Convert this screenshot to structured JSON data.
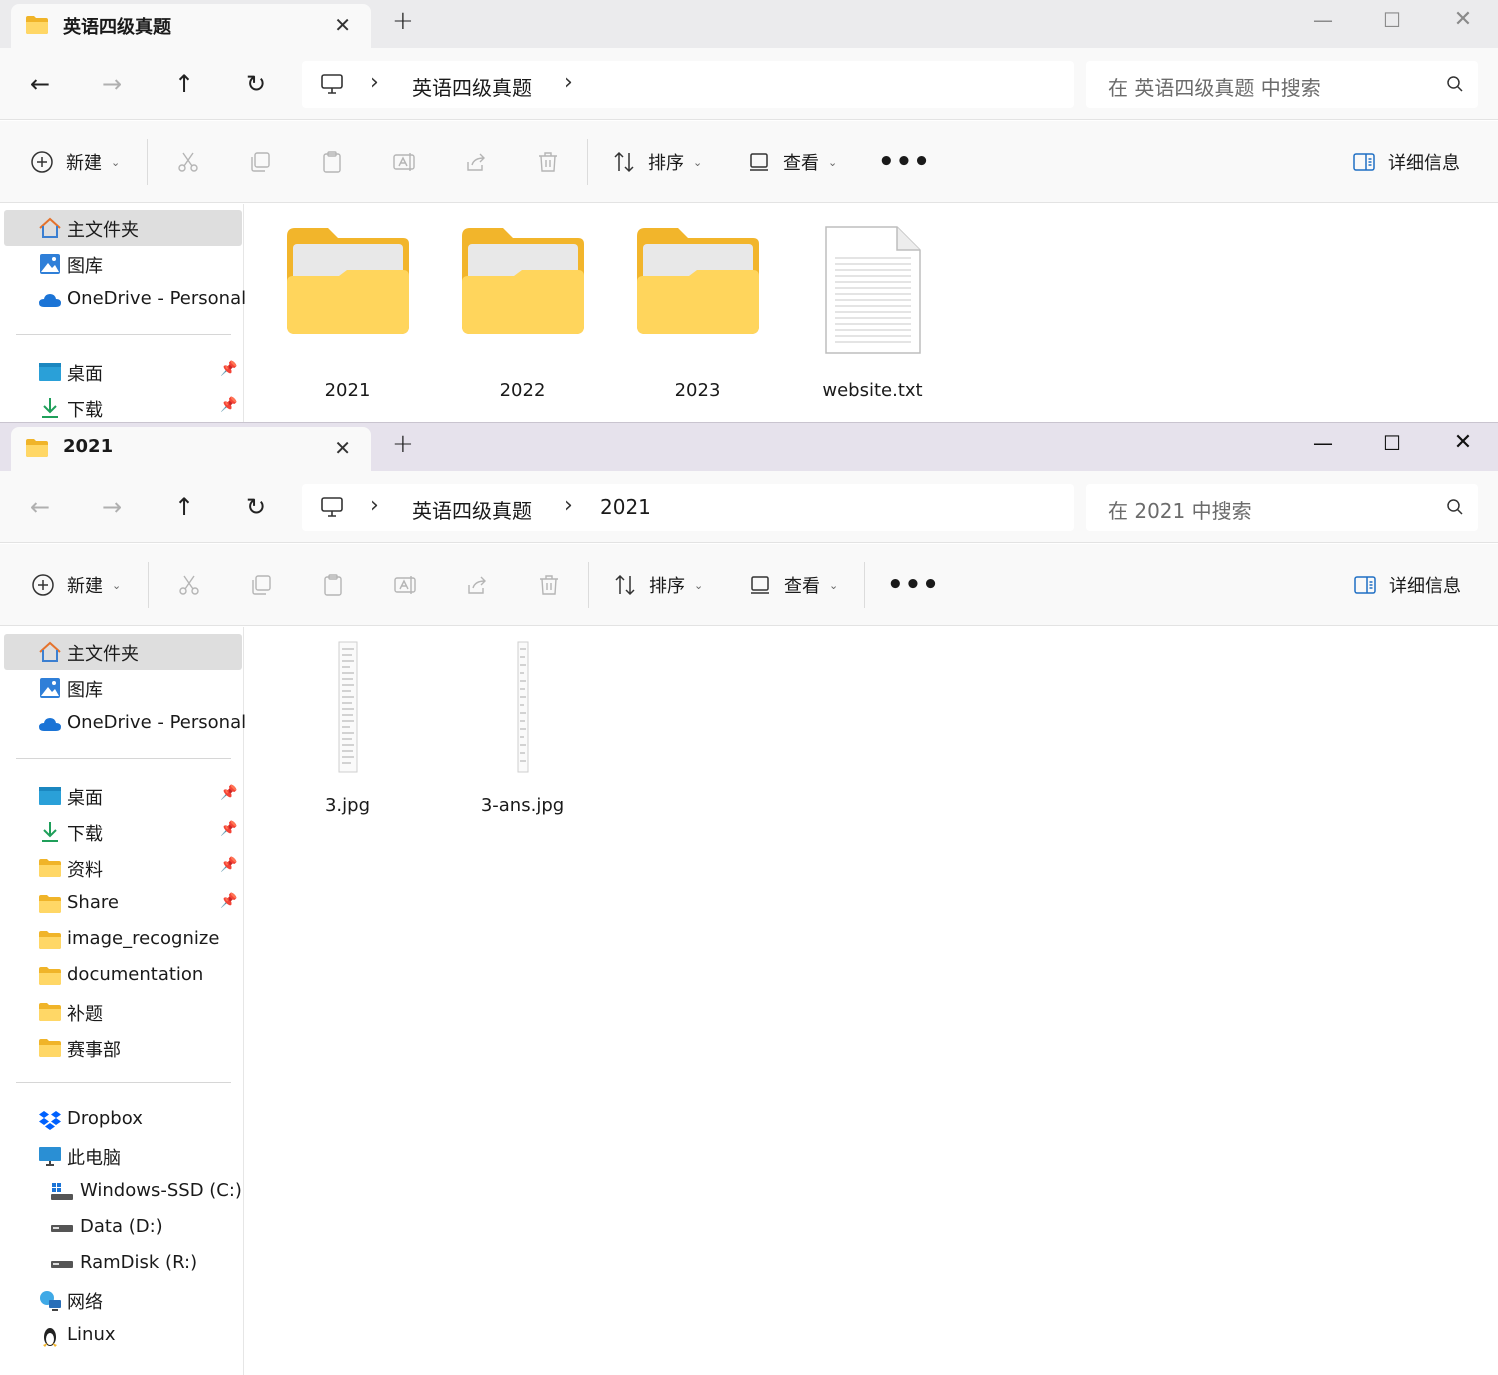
{
  "windows": [
    {
      "tab_title": "英语四级真题",
      "address": [
        "英语四级真题"
      ],
      "search_placeholder": "在 英语四级真题 中搜索",
      "toolbar": {
        "new": "新建",
        "sort": "排序",
        "view": "查看",
        "more": "•••",
        "details": "详细信息"
      },
      "sidebar": {
        "home": "主文件夹",
        "gallery": "图库",
        "onedrive": "OneDrive - Personal",
        "desktop": "桌面",
        "downloads": "下载"
      },
      "files": [
        {
          "name": "2021",
          "type": "folder"
        },
        {
          "name": "2022",
          "type": "folder"
        },
        {
          "name": "2023",
          "type": "folder"
        },
        {
          "name": "website.txt",
          "type": "text"
        }
      ]
    },
    {
      "tab_title": "2021",
      "address": [
        "英语四级真题",
        "2021"
      ],
      "search_placeholder": "在 2021 中搜索",
      "toolbar": {
        "new": "新建",
        "sort": "排序",
        "view": "查看",
        "more": "•••",
        "details": "详细信息"
      },
      "sidebar": {
        "home": "主文件夹",
        "gallery": "图库",
        "onedrive": "OneDrive - Personal",
        "desktop": "桌面",
        "downloads": "下载",
        "ziliao": "资料",
        "share": "Share",
        "image_recognize": "image_recognize",
        "documentation": "documentation",
        "buti": "补题",
        "saishibu": "赛事部",
        "dropbox": "Dropbox",
        "this_pc": "此电脑",
        "drive_c": "Windows-SSD (C:)",
        "drive_d": "Data (D:)",
        "drive_r": "RamDisk (R:)",
        "network": "网络",
        "linux": "Linux"
      },
      "files": [
        {
          "name": "3.jpg",
          "type": "image"
        },
        {
          "name": "3-ans.jpg",
          "type": "image"
        }
      ]
    }
  ]
}
